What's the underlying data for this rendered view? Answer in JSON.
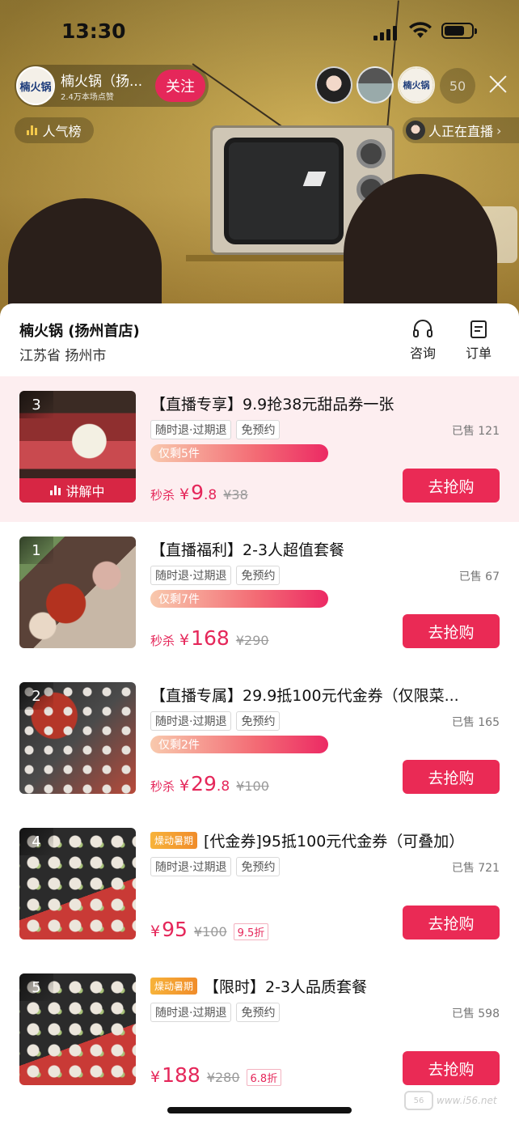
{
  "status_bar": {
    "time": "13:30"
  },
  "live": {
    "anchor_logo": "楠火锅",
    "anchor_name": "楠火锅（扬...",
    "likes": "2.4万本场点赞",
    "follow_label": "关注",
    "viewer_count": "50",
    "rank_label": "人气榜",
    "now_live_label": "人正在直播"
  },
  "shop": {
    "name": "楠火锅 (扬州首店)",
    "location": "江苏省 扬州市",
    "consult_label": "咨询",
    "order_label": "订单"
  },
  "items": [
    {
      "num": "3",
      "explain": "讲解中",
      "promo": "",
      "title": "【直播专享】9.9抢38元甜品券一张",
      "tags": [
        "随时退·过期退",
        "免预约"
      ],
      "sold": "已售 121",
      "remain": "仅剩5件",
      "price_label": "秒杀",
      "currency": "¥",
      "price_int": "9",
      "price_dec": ".8",
      "orig": "¥38",
      "discount": "",
      "buy": "去抢购"
    },
    {
      "num": "1",
      "title": "【直播福利】2-3人超值套餐",
      "tags": [
        "随时退·过期退",
        "免预约"
      ],
      "sold": "已售 67",
      "remain": "仅剩7件",
      "price_label": "秒杀",
      "currency": "¥",
      "price_int": "168",
      "price_dec": "",
      "orig": "¥290",
      "buy": "去抢购"
    },
    {
      "num": "2",
      "title": "【直播专属】29.9抵100元代金券（仅限菜...",
      "tags": [
        "随时退·过期退",
        "免预约"
      ],
      "sold": "已售 165",
      "remain": "仅剩2件",
      "price_label": "秒杀",
      "currency": "¥",
      "price_int": "29",
      "price_dec": ".8",
      "orig": "¥100",
      "buy": "去抢购"
    },
    {
      "num": "4",
      "promo": "燥动暑期",
      "title": "[代金券]95抵100元代金券（可叠加）",
      "tags": [
        "随时退·过期退",
        "免预约"
      ],
      "sold": "已售 721",
      "currency": "¥",
      "price_int": "95",
      "orig": "¥100",
      "discount": "9.5折",
      "buy": "去抢购"
    },
    {
      "num": "5",
      "promo": "燥动暑期",
      "title": "【限时】2-3人品质套餐",
      "tags": [
        "随时退·过期退",
        "免预约"
      ],
      "sold": "已售 598",
      "currency": "¥",
      "price_int": "188",
      "orig": "¥280",
      "discount": "6.8折",
      "buy": "去抢购"
    }
  ],
  "watermark": "www.i56.net",
  "colors": {
    "accent": "#ea2a55",
    "active_row": "#fdeef0",
    "promo": "#f7b33a"
  }
}
